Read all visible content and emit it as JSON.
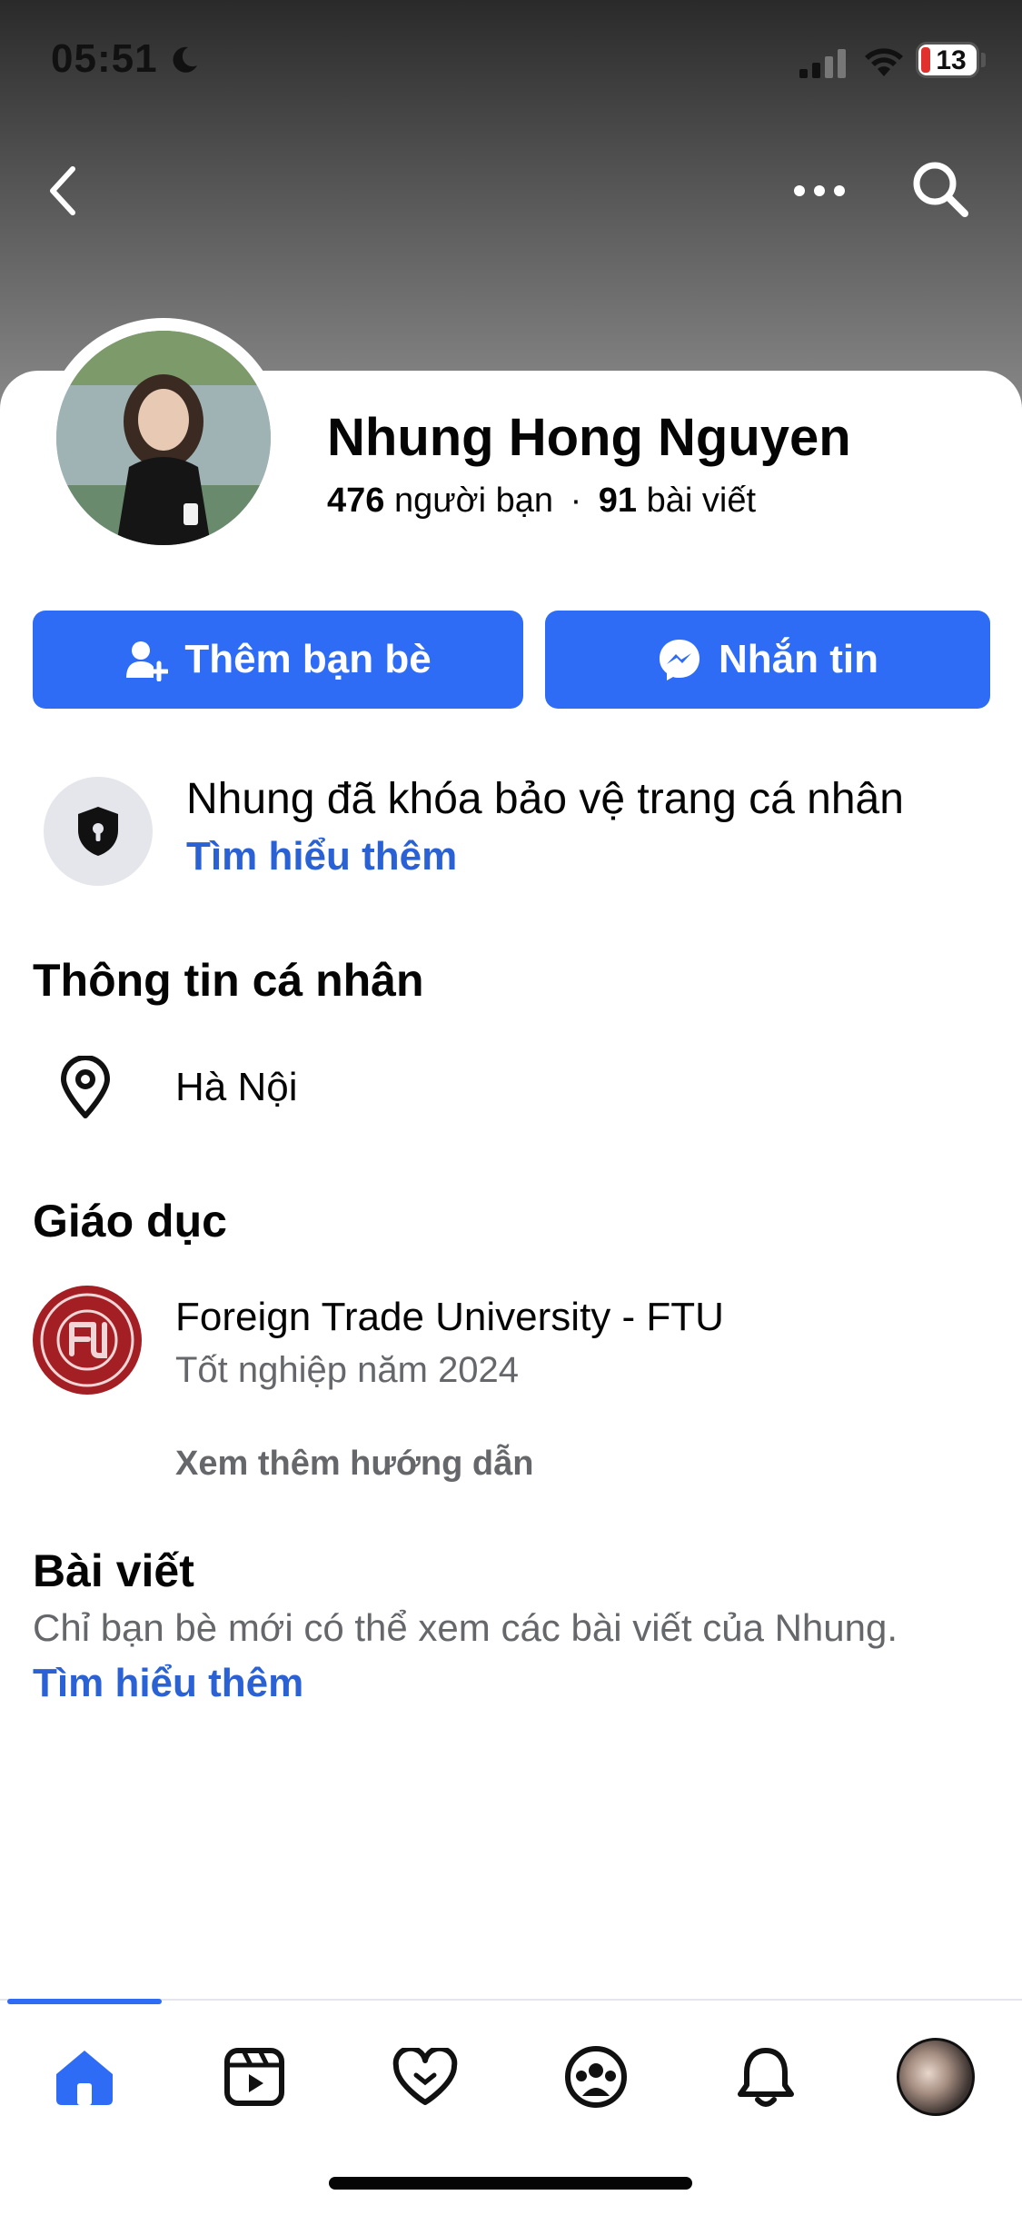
{
  "status_bar": {
    "time": "05:51",
    "battery": "13"
  },
  "profile": {
    "name": "Nhung Hong Nguyen",
    "friends_count": "476",
    "friends_label": "người bạn",
    "separator": "·",
    "posts_count": "91",
    "posts_label": "bài viết"
  },
  "actions": {
    "add_friend": "Thêm bạn bè",
    "message": "Nhắn tin"
  },
  "lock_notice": {
    "text": "Nhung đã khóa bảo vệ trang cá nhân",
    "link": "Tìm hiểu thêm"
  },
  "personal_info": {
    "title": "Thông tin cá nhân",
    "location": "Hà Nội"
  },
  "education": {
    "title": "Giáo dục",
    "school": "Foreign Trade University - FTU",
    "detail": "Tốt nghiệp năm 2024",
    "see_more": "Xem thêm hướng dẫn"
  },
  "posts": {
    "title": "Bài viết",
    "text": "Chỉ bạn bè mới có thể xem các bài viết của Nhung.",
    "link": "Tìm hiểu thêm"
  },
  "tab_bar": {
    "items": [
      "home-icon",
      "video-icon",
      "dating-heart-icon",
      "groups-icon",
      "bell-icon",
      "profile-avatar"
    ],
    "active": "home-icon"
  },
  "colors": {
    "accent": "#2e6cf6",
    "link": "#2a62d6",
    "muted": "#65676b"
  }
}
